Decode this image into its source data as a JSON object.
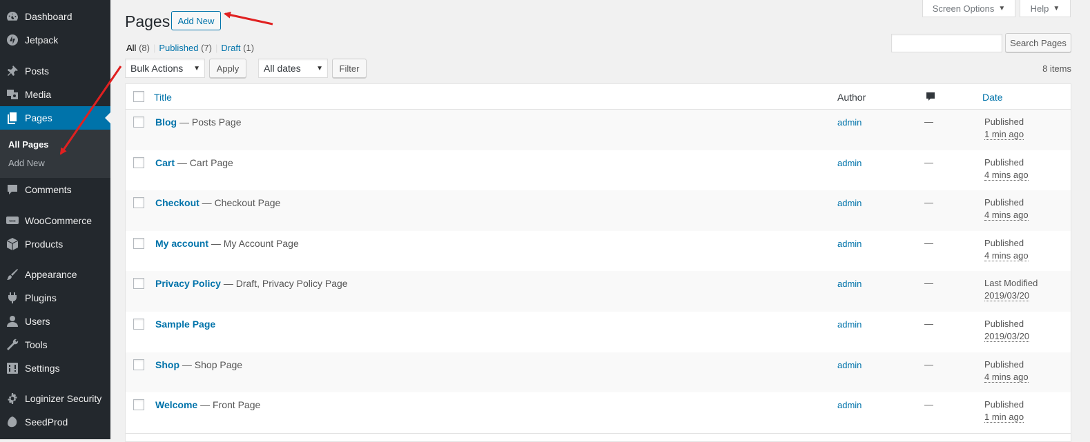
{
  "sidebar": {
    "items": [
      {
        "label": "Dashboard",
        "icon": "dashboard-icon"
      },
      {
        "label": "Jetpack",
        "icon": "jetpack-icon"
      },
      {
        "label": "Posts",
        "icon": "pin-icon"
      },
      {
        "label": "Media",
        "icon": "media-icon"
      },
      {
        "label": "Pages",
        "icon": "pages-icon"
      },
      {
        "label": "Comments",
        "icon": "comment-icon"
      },
      {
        "label": "WooCommerce",
        "icon": "woo-icon"
      },
      {
        "label": "Products",
        "icon": "box-icon"
      },
      {
        "label": "Appearance",
        "icon": "brush-icon"
      },
      {
        "label": "Plugins",
        "icon": "plug-icon"
      },
      {
        "label": "Users",
        "icon": "user-icon"
      },
      {
        "label": "Tools",
        "icon": "wrench-icon"
      },
      {
        "label": "Settings",
        "icon": "settings-icon"
      },
      {
        "label": "Loginizer Security",
        "icon": "gear-icon"
      },
      {
        "label": "SeedProd",
        "icon": "seed-icon"
      }
    ],
    "submenu": [
      "All Pages",
      "Add New"
    ]
  },
  "header": {
    "title": "Pages",
    "add_new": "Add New",
    "screen_options": "Screen Options",
    "help": "Help"
  },
  "filters": {
    "all": "All",
    "all_count": "(8)",
    "published": "Published",
    "published_count": "(7)",
    "draft": "Draft",
    "draft_count": "(1)",
    "bulk_actions": "Bulk Actions",
    "apply": "Apply",
    "all_dates": "All dates",
    "filter": "Filter",
    "search_button": "Search Pages",
    "search_value": "",
    "items_count": "8 items"
  },
  "table": {
    "headers": {
      "title": "Title",
      "author": "Author",
      "date": "Date"
    },
    "rows": [
      {
        "title": "Blog",
        "suffix": " — Posts Page",
        "author": "admin",
        "comments": "—",
        "status": "Published",
        "date": "1 min ago"
      },
      {
        "title": "Cart",
        "suffix": " — Cart Page",
        "author": "admin",
        "comments": "—",
        "status": "Published",
        "date": "4 mins ago"
      },
      {
        "title": "Checkout",
        "suffix": " — Checkout Page",
        "author": "admin",
        "comments": "—",
        "status": "Published",
        "date": "4 mins ago"
      },
      {
        "title": "My account",
        "suffix": " — My Account Page",
        "author": "admin",
        "comments": "—",
        "status": "Published",
        "date": "4 mins ago"
      },
      {
        "title": "Privacy Policy",
        "suffix": " — Draft, Privacy Policy Page",
        "author": "admin",
        "comments": "—",
        "status": "Last Modified",
        "date": "2019/03/20"
      },
      {
        "title": "Sample Page",
        "suffix": "",
        "author": "admin",
        "comments": "—",
        "status": "Published",
        "date": "2019/03/20"
      },
      {
        "title": "Shop",
        "suffix": " — Shop Page",
        "author": "admin",
        "comments": "—",
        "status": "Published",
        "date": "4 mins ago"
      },
      {
        "title": "Welcome",
        "suffix": " — Front Page",
        "author": "admin",
        "comments": "—",
        "status": "Published",
        "date": "1 min ago"
      }
    ]
  },
  "colors": {
    "sidebar_bg": "#23282d",
    "accent": "#0073aa",
    "annotation_arrow": "#e02020"
  }
}
